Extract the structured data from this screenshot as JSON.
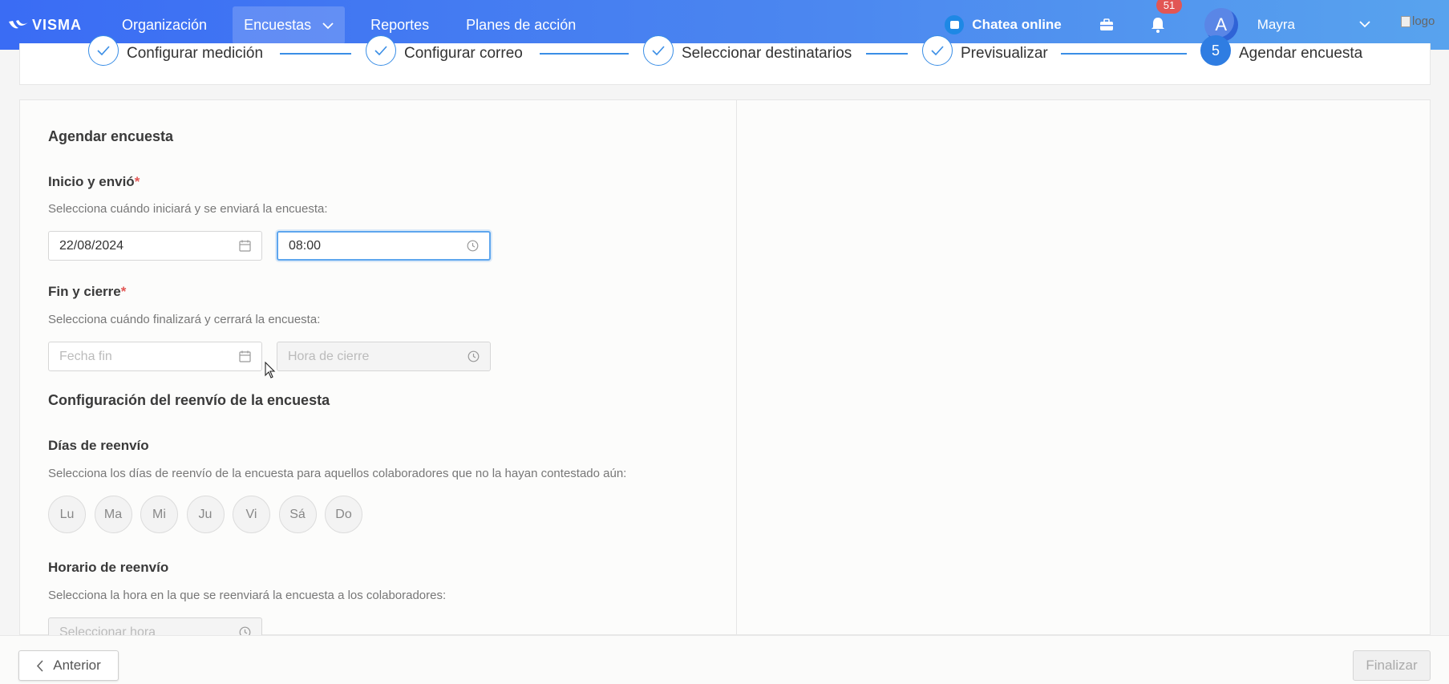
{
  "topnav": {
    "brand": "VISMA",
    "items": [
      {
        "label": "Organización"
      },
      {
        "label": "Encuestas"
      },
      {
        "label": "Reportes"
      },
      {
        "label": "Planes de acción"
      }
    ],
    "chat_label": "Chatea online",
    "notifications_count": "51",
    "avatar_initial": "A",
    "user_name": "Mayra",
    "logo_alt": "logo"
  },
  "stepper": {
    "steps": [
      {
        "label": "Configurar medición",
        "status": "done"
      },
      {
        "label": "Configurar correo",
        "status": "done"
      },
      {
        "label": "Seleccionar destinatarios",
        "status": "done"
      },
      {
        "label": "Previsualizar",
        "status": "done"
      },
      {
        "label": "Agendar encuesta",
        "status": "current",
        "number": "5"
      }
    ]
  },
  "form": {
    "title": "Agendar encuesta",
    "start": {
      "label": "Inicio y envió",
      "required_mark": "*",
      "description": "Selecciona cuándo iniciará y se enviará la encuesta:",
      "date_value": "22/08/2024",
      "time_value": "08:00"
    },
    "end": {
      "label": "Fin y cierre",
      "required_mark": "*",
      "description": "Selecciona cuándo finalizará y cerrará la encuesta:",
      "date_placeholder": "Fecha fin",
      "time_placeholder": "Hora de cierre"
    },
    "resend_title": "Configuración del reenvío de la encuesta",
    "resend_days": {
      "label": "Días de reenvío",
      "description": "Selecciona los días de reenvío de la encuesta para aquellos colaboradores que no la hayan contestado aún:",
      "days": [
        "Lu",
        "Ma",
        "Mi",
        "Ju",
        "Vi",
        "Sá",
        "Do"
      ]
    },
    "resend_time": {
      "label": "Horario de reenvío",
      "description": "Selecciona la hora en la que se reenviará la encuesta a los colaboradores:",
      "placeholder": "Seleccionar hora"
    }
  },
  "footer": {
    "prev_label": "Anterior",
    "finish_label": "Finalizar"
  },
  "colors": {
    "accent": "#2f7de2",
    "required": "#e25654",
    "badge": "#e25654"
  }
}
